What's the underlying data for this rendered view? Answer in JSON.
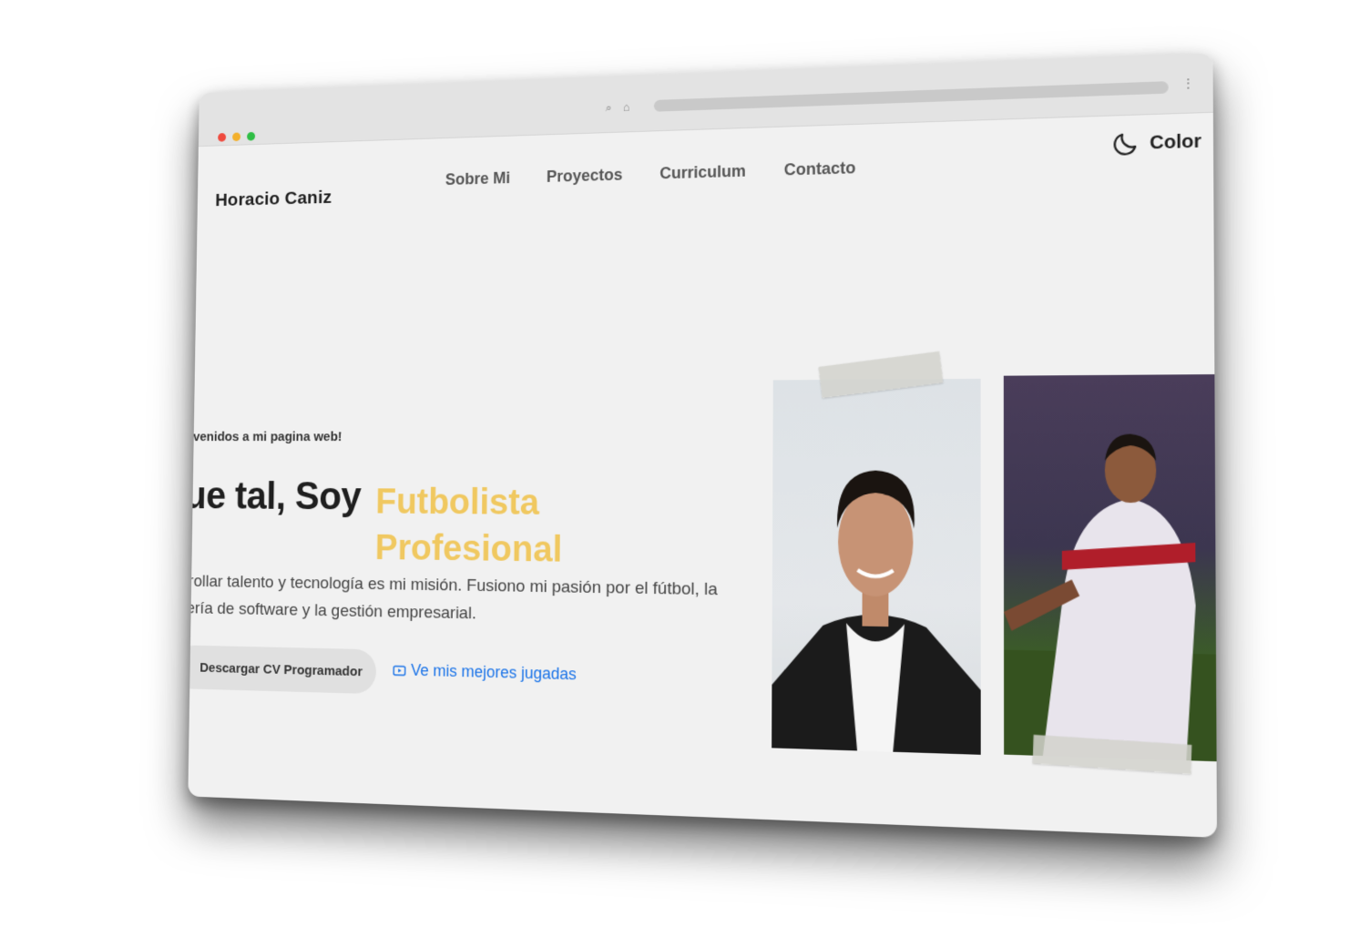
{
  "header": {
    "brand": "Horacio Caniz",
    "nav": [
      "Sobre Mi",
      "Proyectos",
      "Curriculum",
      "Contacto"
    ],
    "theme_label": "Color"
  },
  "hero": {
    "welcome": "nvenidos a mi pagina web!",
    "title_prefix": "ue tal, Soy",
    "role_line1": "Futbolista",
    "role_line2": "Profesional",
    "description": "rrollar talento y tecnología es mi misión. Fusiono mi pasión por el fútbol, la ",
    "description2": "iería de software y la gestión empresarial.",
    "cv_button": "Descargar CV Programador",
    "video_link": "Ve mis mejores jugadas"
  },
  "colors": {
    "accent": "#f0c860",
    "link": "#1a73e8",
    "background": "#f1f1f1"
  }
}
